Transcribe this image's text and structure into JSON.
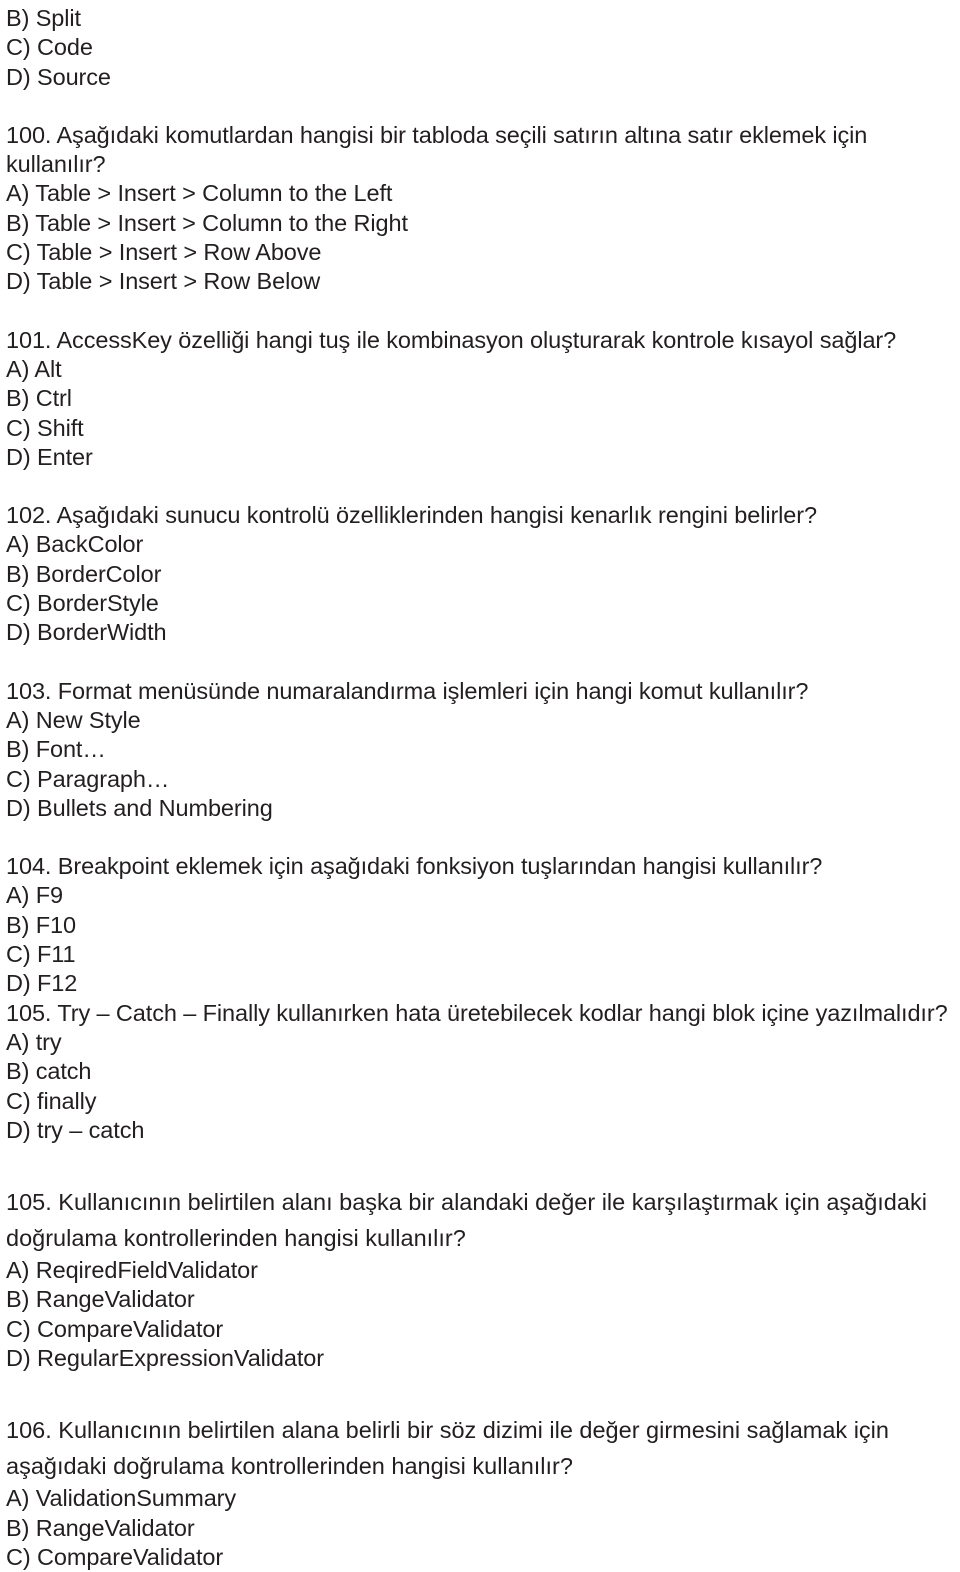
{
  "document": {
    "language": "tr",
    "text_color": "#231f20",
    "background_color": "#ffffff",
    "leading_options": {
      "continued_question_label": "previous question options continued"
    }
  },
  "continued_options": {
    "b": "B) Split",
    "c": "C) Code",
    "d": "D) Source"
  },
  "questions": [
    {
      "number": "100.",
      "prompt": "100. Aşağıdaki komutlardan hangisi bir tabloda seçili satırın altına satır eklemek için kullanılır?",
      "options": [
        "A) Table > Insert > Column to the Left",
        "B) Table > Insert > Column to the Right",
        "C) Table > Insert > Row Above",
        "D) Table > Insert > Row Below"
      ]
    },
    {
      "number": "101.",
      "prompt": "101. AccessKey özelliği hangi tuş ile kombinasyon oluşturarak kontrole kısayol sağlar?",
      "options": [
        "A) Alt",
        "B) Ctrl",
        "C) Shift",
        "D) Enter"
      ]
    },
    {
      "number": "102.",
      "prompt": "102. Aşağıdaki sunucu kontrolü özelliklerinden hangisi kenarlık rengini belirler?",
      "options": [
        "A) BackColor",
        "B) BorderColor",
        "C) BorderStyle",
        "D) BorderWidth"
      ]
    },
    {
      "number": "103.",
      "prompt": "103. Format menüsünde numaralandırma işlemleri için hangi komut kullanılır?",
      "options": [
        "A) New Style",
        "B) Font…",
        "C) Paragraph…",
        "D) Bullets and Numbering"
      ]
    },
    {
      "number": "104.",
      "prompt": "104. Breakpoint eklemek için aşağıdaki fonksiyon tuşlarından hangisi kullanılır?",
      "options": [
        "A) F9",
        "B) F10",
        "C) F11",
        "D) F12"
      ]
    },
    {
      "number": "105.",
      "prompt": "105. Try – Catch – Finally kullanırken hata üretebilecek kodlar hangi blok içine yazılmalıdır?",
      "options": [
        "A) try",
        "B) catch",
        "C) finally",
        "D) try – catch"
      ]
    },
    {
      "number": "105.",
      "prompt": "105. Kullanıcının belirtilen alanı başka bir alandaki değer ile karşılaştırmak için aşağıdaki doğrulama kontrollerinden hangisi kullanılır?",
      "options": [
        "A) ReqiredFieldValidator",
        "B) RangeValidator",
        "C) CompareValidator",
        "D) RegularExpressionValidator"
      ]
    },
    {
      "number": "106.",
      "prompt": "106. Kullanıcının belirtilen alana belirli bir söz dizimi ile değer girmesini sağlamak için aşağıdaki doğrulama kontrollerinden hangisi kullanılır?",
      "options": [
        "A) ValidationSummary",
        "B) RangeValidator",
        "C) CompareValidator"
      ]
    }
  ]
}
